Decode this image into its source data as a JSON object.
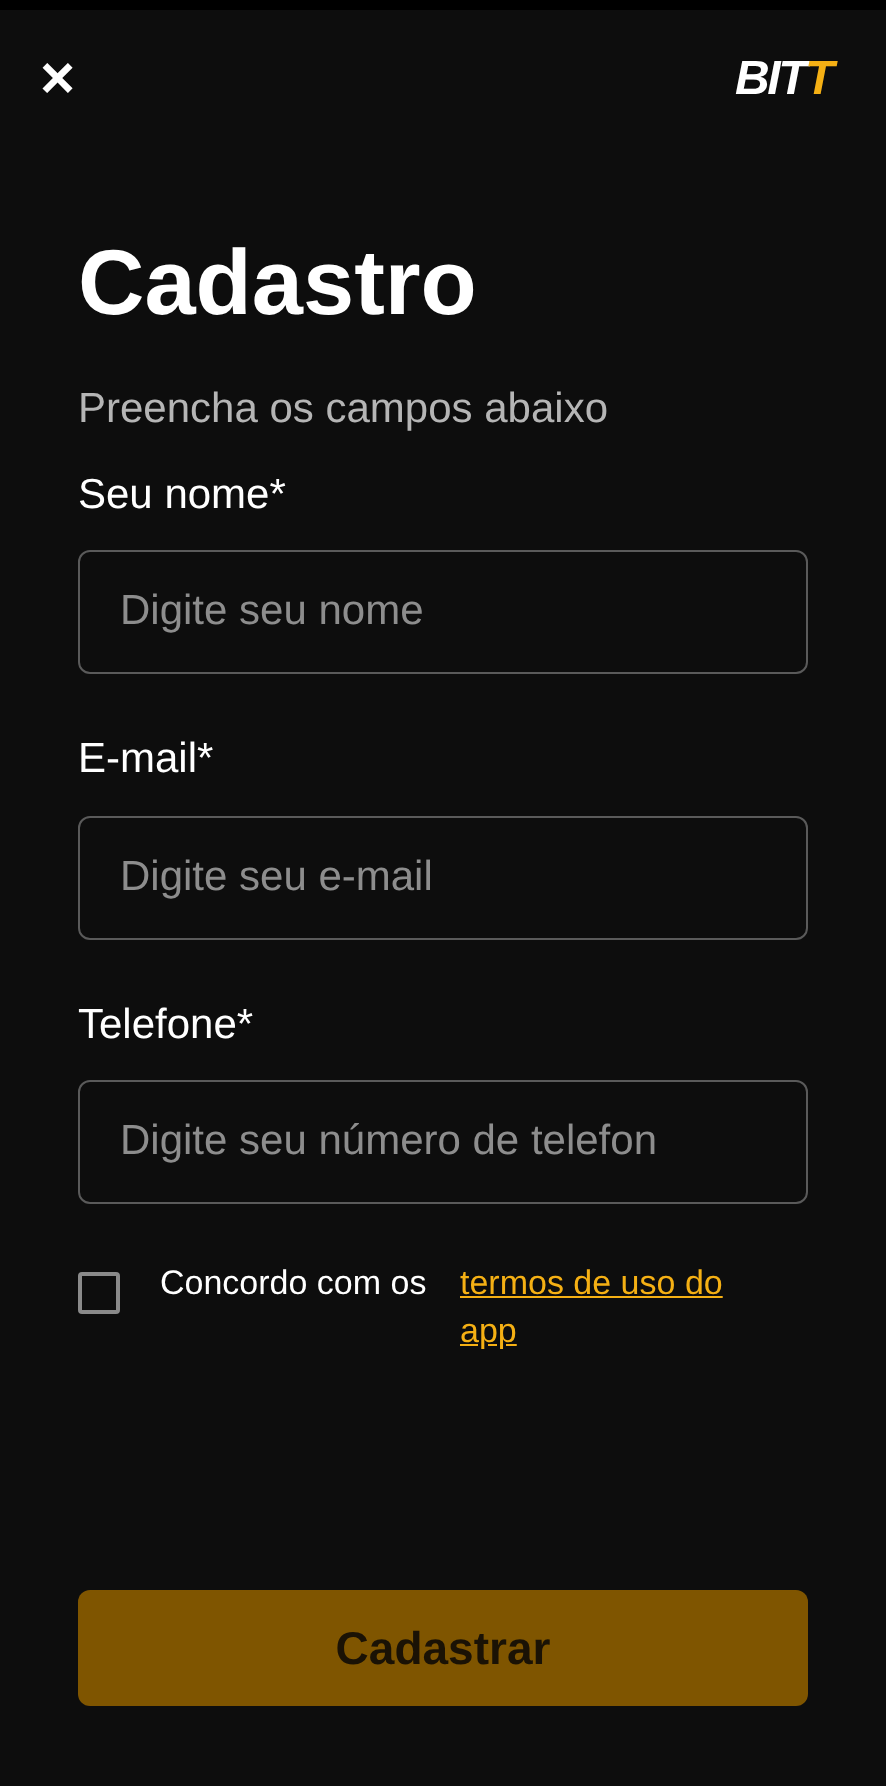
{
  "header": {
    "close": "×",
    "logo": {
      "text": "BIT",
      "accent": "T"
    }
  },
  "title": "Cadastro",
  "subtitle": "Preencha os campos abaixo",
  "fields": [
    {
      "label": "Seu nome*",
      "placeholder": "Digite seu nome"
    },
    {
      "label": "E-mail*",
      "placeholder": "Digite seu e-mail"
    },
    {
      "label": "Telefone*",
      "placeholder": "Digite seu número de telefon"
    }
  ],
  "terms": {
    "checked": false,
    "text": "Concordo com os",
    "link": "termos de uso do app"
  },
  "submit": {
    "label": "Cadastrar",
    "disabled": true
  }
}
